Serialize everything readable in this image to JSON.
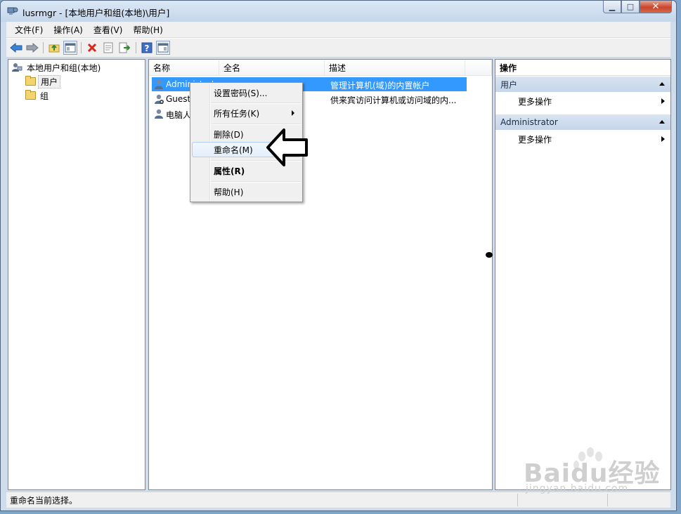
{
  "window": {
    "title": "lusrmgr - [本地用户和组(本地)\\用户]",
    "caption": {
      "minimize": "▁",
      "maximize": "□",
      "close": "✕"
    }
  },
  "menu": [
    "文件(F)",
    "操作(A)",
    "查看(V)",
    "帮助(H)"
  ],
  "toolbar": {
    "icons": [
      "back-icon",
      "forward-icon",
      "up-folder-icon",
      "show-hide-tree-icon",
      "delete-icon",
      "properties-icon",
      "export-list-icon",
      "help-icon",
      "show-hide-action-pane-icon"
    ]
  },
  "tree": {
    "root": "本地用户和组(本地)",
    "items": [
      "用户",
      "组"
    ]
  },
  "list": {
    "columns": [
      "名称",
      "全名",
      "描述"
    ],
    "rows": [
      {
        "name": "Administrator",
        "fullname": "",
        "description": "管理计算机(域)的内置帐户",
        "selected": true
      },
      {
        "name": "Guest",
        "fullname": "",
        "description": "供来宾访问计算机或访问域的内...",
        "selected": false
      },
      {
        "name": "电脑人",
        "fullname": "",
        "description": "",
        "selected": false
      }
    ]
  },
  "context_menu": {
    "items": [
      "设置密码(S)...",
      "所有任务(K)",
      "删除(D)",
      "重命名(M)",
      "属性(R)",
      "帮助(H)"
    ],
    "hovered": "重命名(M)"
  },
  "actions": {
    "title": "操作",
    "sections": [
      {
        "header": "用户",
        "item": "更多操作"
      },
      {
        "header": "Administrator",
        "item": "更多操作"
      }
    ]
  },
  "status": "重命名当前选择。",
  "watermark": {
    "brand": "Baidu经验",
    "url": "jingyan.baidu.com"
  },
  "colors": {
    "selection": "#3399ff",
    "accent_header": "#c6d5e9",
    "close_button": "#c9452c"
  }
}
